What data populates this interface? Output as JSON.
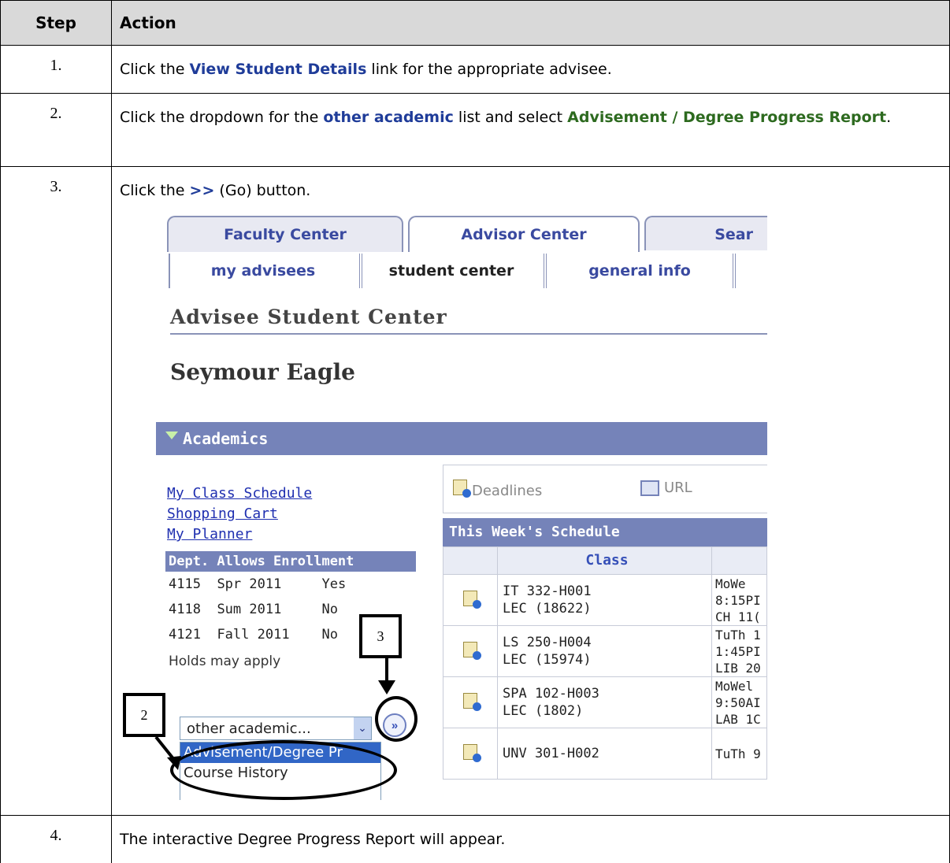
{
  "table": {
    "header_step": "Step",
    "header_action": "Action",
    "rows": [
      {
        "num": "1.",
        "pre": "Click the ",
        "b1": "View Student Details",
        "post": " link for the appropriate advisee."
      },
      {
        "num": "2.",
        "pre": "Click the dropdown for the ",
        "b1": "other academic",
        "mid": " list and select ",
        "b2": "Advisement / Degree Progress Report",
        "post": "."
      },
      {
        "num": "3.",
        "pre": "Click the ",
        "b1": ">>",
        "post": " (Go) button."
      },
      {
        "num": "4.",
        "text": "The interactive Degree Progress Report will appear."
      }
    ]
  },
  "screenshot": {
    "tabs": [
      "Faculty Center",
      "Advisor Center",
      "Sear"
    ],
    "subtabs": [
      "my advisees",
      "student center",
      "general info"
    ],
    "page_title": "Advisee Student Center",
    "student_name": "Seymour Eagle",
    "section_title": "Academics",
    "links": [
      "My Class Schedule",
      "Shopping Cart",
      "My Planner"
    ],
    "dept_header": "Dept. Allows Enrollment",
    "terms": [
      {
        "code": "4115",
        "term": "Spr 2011",
        "allowed": "Yes"
      },
      {
        "code": "4118",
        "term": "Sum 2011",
        "allowed": "No"
      },
      {
        "code": "4121",
        "term": "Fall 2011",
        "allowed": "No"
      }
    ],
    "holds_text": "Holds may apply",
    "dropdown_value": "other academic...",
    "dropdown_options": [
      "Advisement/Degree Pr",
      "Course History"
    ],
    "go_symbol": "»",
    "deadlines_label": "Deadlines",
    "url_label": "URL",
    "schedule_title": "This Week's Schedule",
    "class_header": "Class",
    "classes": [
      {
        "course": "IT 332-H001",
        "section": "LEC (18622)",
        "time": [
          "MoWe",
          "8:15PI",
          "CH 11("
        ]
      },
      {
        "course": "LS 250-H004",
        "section": "LEC (15974)",
        "time": [
          "TuTh 1",
          "1:45PI",
          "LIB 20"
        ]
      },
      {
        "course": "SPA 102-H003",
        "section": "LEC (1802)",
        "time": [
          "MoWel",
          "9:50AI",
          "LAB 1C"
        ]
      },
      {
        "course": "UNV 301-H002",
        "section": "",
        "time": [
          "TuTh 9"
        ]
      }
    ],
    "callouts": [
      "2",
      "3"
    ]
  }
}
